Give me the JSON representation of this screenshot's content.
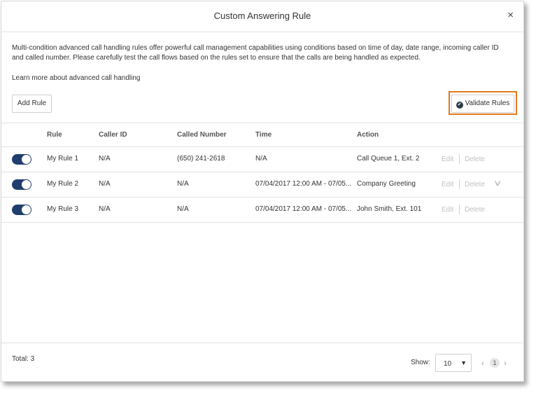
{
  "dialog": {
    "title": "Custom Answering Rule",
    "close_icon": "×",
    "description": "Multi-condition advanced call handling rules offer powerful call management capabilities using conditions based on time of day, date range, incoming caller ID and called number. Please carefully test the call flows based on the rules set to ensure that the calls are being handled as expected.",
    "learn_more": "Learn more about advanced call handling",
    "add_rule_label": "Add Rule",
    "validate_label": "Validate Rules",
    "validate_icon": "✔",
    "highlight_color": "#e2791a"
  },
  "table": {
    "headers": {
      "rule": "Rule",
      "caller_id": "Caller ID",
      "called_number": "Called Number",
      "time": "Time",
      "action": "Action"
    },
    "rows": [
      {
        "enabled": true,
        "rule": "My Rule 1",
        "caller_id": "N/A",
        "called_number": "(650) 241-2618",
        "time": "N/A",
        "action": "Call Queue 1, Ext. 2",
        "edit": "Edit",
        "delete": "Delete"
      },
      {
        "enabled": true,
        "rule": "My Rule 2",
        "caller_id": "N/A",
        "called_number": "N/A",
        "time": "07/04/2017 12:00 AM - 07/05...",
        "action": "Company Greeting",
        "edit": "Edit",
        "delete": "Delete"
      },
      {
        "enabled": true,
        "rule": "My Rule 3",
        "caller_id": "N/A",
        "called_number": "N/A",
        "time": "07/04/2017 12:00 AM - 07/05...",
        "action": "John Smith, Ext. 101",
        "edit": "Edit",
        "delete": "Delete"
      }
    ],
    "toggle_color": "#1f3e6e"
  },
  "footer": {
    "total": "Total: 3",
    "show_label": "Show:",
    "show_value": "10",
    "current_page": "1",
    "prev_icon": "‹",
    "next_icon": "›"
  }
}
